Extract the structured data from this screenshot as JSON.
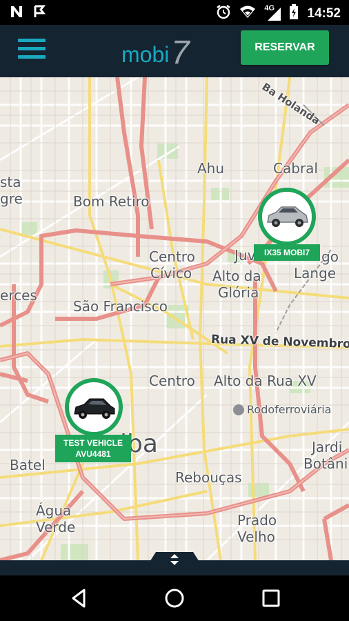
{
  "status_bar": {
    "time": "14:52",
    "network_label": "4G",
    "icons": [
      "notification-n-icon",
      "notification-flag-icon",
      "alarm-icon",
      "wifi-icon",
      "signal-icon",
      "battery-icon"
    ]
  },
  "app_bar": {
    "logo_text": "mobi7",
    "menu_icon": "hamburger-menu-icon",
    "reserve_label": "RESERVAR",
    "colors": {
      "background": "#152431",
      "accent": "#19a9c0",
      "primary": "#1fa55a"
    }
  },
  "map": {
    "labels": {
      "holanda": "Ba Holanda",
      "ahu": "Ahu",
      "cabral": "Cabral",
      "sta": "sta",
      "gre": "gre",
      "bom_retiro": "Bom Retiro",
      "centro_civico_1": "Centro",
      "centro_civico_2": "Cívico",
      "juv": "Juv",
      "go": "go",
      "lange": "Lange",
      "alto_gloria_1": "Alto da",
      "alto_gloria_2": "Glória",
      "erces": "erces",
      "sao_francisco": "São Francisco",
      "rua_xv": "Rua XV de Novembro",
      "centro": "Centro",
      "alto_rua_xv": "Alto da Rua XV",
      "rodoferroviaria": "Rodoferroviária",
      "jardim_1": "Jardi",
      "jardim_2": "Botâni",
      "iba": "iba",
      "batel": "Batel",
      "reboucas": "Rebouças",
      "agua_verde_1": "Água",
      "agua_verde_2": "Verde",
      "prado_velho_1": "Prado",
      "prado_velho_2": "Velho"
    },
    "vehicles": [
      {
        "tag_line1": "IX35 MOBI7",
        "tag_line2": "",
        "car_color": "silver",
        "icon": "car-suv-icon"
      },
      {
        "tag_line1": "TEST VEHICLE",
        "tag_line2": "AVU4481",
        "car_color": "black",
        "icon": "car-hatchback-icon"
      }
    ]
  },
  "bottom_panel": {
    "handle_icon": "expand-collapse-arrows-icon"
  },
  "nav_bar": {
    "icons": [
      "back-triangle-icon",
      "home-circle-icon",
      "recents-square-icon"
    ]
  }
}
